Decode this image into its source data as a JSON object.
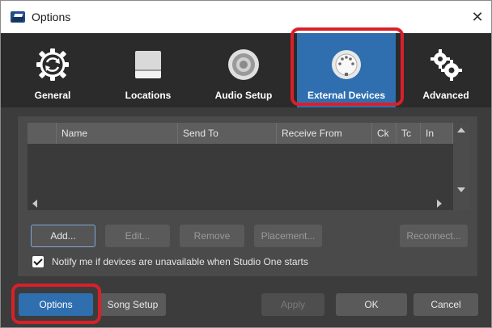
{
  "window": {
    "title": "Options",
    "close_glyph": "✕"
  },
  "tabs": [
    {
      "id": "general",
      "label": "General",
      "icon": "gear-refresh-icon"
    },
    {
      "id": "locations",
      "label": "Locations",
      "icon": "drive-icon"
    },
    {
      "id": "audio",
      "label": "Audio Setup",
      "icon": "speaker-icon"
    },
    {
      "id": "external",
      "label": "External Devices",
      "icon": "midi-connector-icon",
      "active": true
    },
    {
      "id": "advanced",
      "label": "Advanced",
      "icon": "gears-icon"
    }
  ],
  "device_table": {
    "columns": [
      "Name",
      "Send To",
      "Receive From",
      "Ck",
      "Tc",
      "In"
    ],
    "rows": []
  },
  "device_buttons": {
    "add": "Add...",
    "edit": "Edit...",
    "remove": "Remove",
    "placement": "Placement...",
    "reconnect": "Reconnect..."
  },
  "notify_checkbox": {
    "label": "Notify me if devices are unavailable when Studio One starts",
    "checked": true
  },
  "footer": {
    "options": "Options",
    "song_setup": "Song Setup",
    "apply": "Apply",
    "ok": "OK",
    "cancel": "Cancel"
  },
  "colors": {
    "accent": "#2f6fb0",
    "highlight": "#d8202a",
    "background": "#3c3c3c"
  }
}
